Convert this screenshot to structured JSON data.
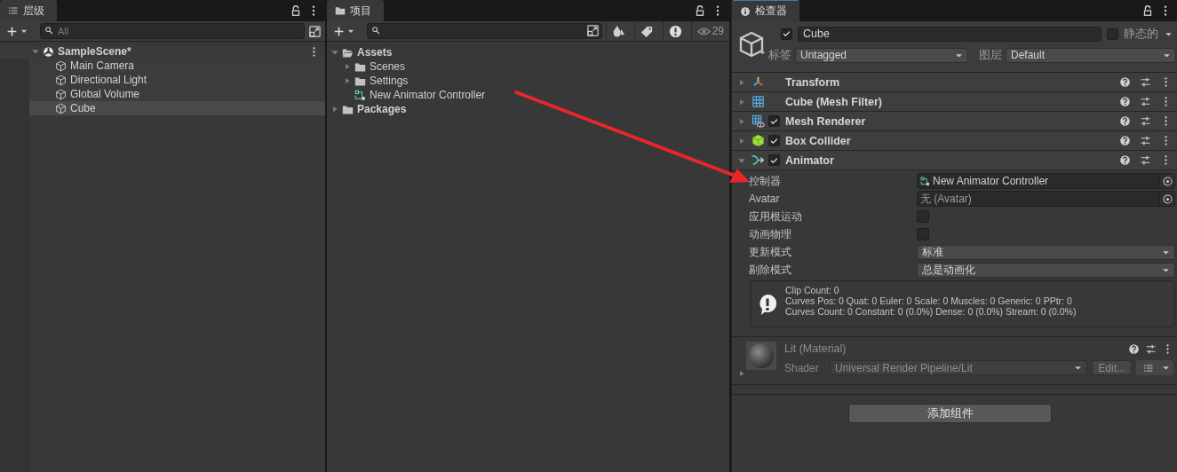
{
  "hierarchy": {
    "tab": {
      "title": "层级",
      "selected": true
    },
    "search": {
      "placeholder": "All"
    },
    "tree": [
      {
        "label": "SampleScene*",
        "kind": "scene",
        "expanded": true,
        "selected": false,
        "children": [
          {
            "label": "Main Camera",
            "kind": "gameobject",
            "selected": false
          },
          {
            "label": "Directional Light",
            "kind": "gameobject",
            "selected": false
          },
          {
            "label": "Global Volume",
            "kind": "gameobject",
            "selected": false
          },
          {
            "label": "Cube",
            "kind": "gameobject",
            "selected": true
          }
        ]
      }
    ]
  },
  "project": {
    "tab": {
      "title": "项目",
      "selected": true
    },
    "hidden_count": "29",
    "tree": [
      {
        "label": "Assets",
        "kind": "folder",
        "expanded": true,
        "children": [
          {
            "label": "Scenes",
            "kind": "folder",
            "expanded": false
          },
          {
            "label": "Settings",
            "kind": "folder",
            "expanded": false
          },
          {
            "label": "New Animator Controller",
            "kind": "animator"
          }
        ]
      },
      {
        "label": "Packages",
        "kind": "folder",
        "expanded": false
      }
    ]
  },
  "inspector": {
    "tab": {
      "title": "检查器",
      "selected": true
    },
    "object": {
      "active": true,
      "name": "Cube",
      "static": false,
      "static_label": "静态的",
      "tag_label": "标签",
      "tag": "Untagged",
      "layer_label": "图层",
      "layer": "Default"
    },
    "components": [
      {
        "name": "Transform",
        "kind": "transform",
        "expanded": false
      },
      {
        "name": "Cube (Mesh Filter)",
        "kind": "mesh_filter",
        "expanded": false
      },
      {
        "name": "Mesh Renderer",
        "kind": "mesh_renderer",
        "enabled": true,
        "expanded": false
      },
      {
        "name": "Box Collider",
        "kind": "box_collider",
        "enabled": true,
        "expanded": false
      },
      {
        "name": "Animator",
        "kind": "animator",
        "enabled": true,
        "expanded": true,
        "properties": [
          {
            "label": "控制器",
            "kind": "object",
            "value": "New Animator Controller",
            "assigned": true
          },
          {
            "label": "Avatar",
            "kind": "object",
            "value": "无 (Avatar)",
            "assigned": false
          },
          {
            "label": "应用根运动",
            "kind": "checkbox",
            "checked": false
          },
          {
            "label": "动画物理",
            "kind": "checkbox",
            "checked": false
          },
          {
            "label": "更新模式",
            "kind": "dropdown",
            "value": "标准"
          },
          {
            "label": "剔除模式",
            "kind": "dropdown",
            "value": "总是动画化"
          }
        ],
        "info": [
          "Clip Count: 0",
          "Curves Pos: 0 Quat: 0 Euler: 0 Scale: 0 Muscles: 0 Generic: 0 PPtr: 0",
          "Curves Count: 0 Constant: 0 (0.0%) Dense: 0 (0.0%) Stream: 0 (0.0%)"
        ]
      }
    ],
    "material": {
      "name": "Lit (Material)",
      "expanded": false,
      "shader_label": "Shader",
      "shader": "Universal Render Pipeline/Lit",
      "edit_button": "Edit..."
    },
    "add_button": "添加组件"
  }
}
